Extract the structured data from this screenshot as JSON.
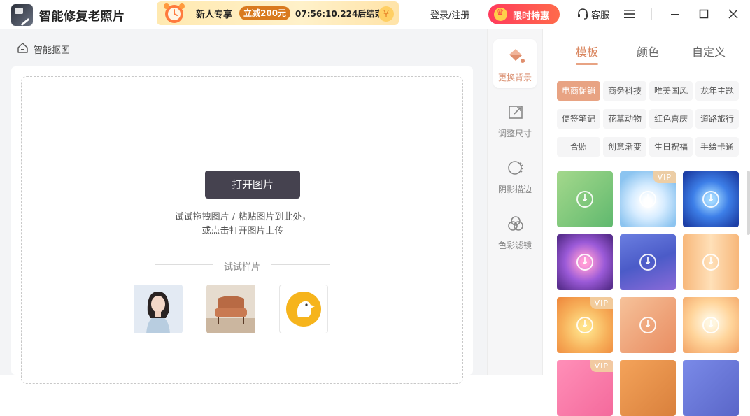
{
  "app": {
    "title": "智能修复老照片"
  },
  "promo": {
    "text": "新人专享",
    "badge": "立减200元",
    "timer": "07:56:10.224后结束"
  },
  "header": {
    "login": "登录/注册",
    "special": "限时特惠",
    "service": "客服"
  },
  "breadcrumb": {
    "label": "智能抠图"
  },
  "canvas": {
    "open_button": "打开图片",
    "hint_line1": "试试拖拽图片 / 粘贴图片到此处，",
    "hint_line2": "或点击打开图片上传",
    "sample_label": "试试样片"
  },
  "tools": [
    {
      "label": "更换背景",
      "icon": "paint-bucket-icon",
      "active": true
    },
    {
      "label": "调整尺寸",
      "icon": "resize-icon",
      "active": false
    },
    {
      "label": "阴影描边",
      "icon": "shadow-icon",
      "active": false
    },
    {
      "label": "色彩滤镜",
      "icon": "color-filter-icon",
      "active": false
    }
  ],
  "right_panel": {
    "tabs": [
      "模板",
      "颜色",
      "自定义"
    ],
    "active_tab": "模板",
    "categories": [
      "电商促销",
      "商务科技",
      "唯美国风",
      "龙年主题",
      "便签笔记",
      "花草动物",
      "红色喜庆",
      "道路旅行",
      "合照",
      "创意渐变",
      "生日祝福",
      "手绘卡通"
    ],
    "active_category": "电商促销",
    "vip_label": "VIP",
    "templates": [
      {
        "vip": false
      },
      {
        "vip": true
      },
      {
        "vip": false
      },
      {
        "vip": false
      },
      {
        "vip": false
      },
      {
        "vip": false
      },
      {
        "vip": true
      },
      {
        "vip": false
      },
      {
        "vip": false
      },
      {
        "vip": true
      },
      {
        "vip": false
      },
      {
        "vip": false
      }
    ]
  },
  "colors": {
    "accent": "#e8a383",
    "dark_button": "#45424f",
    "special_red": "#ff3b5c",
    "promo_orange": "#d97a1f"
  }
}
